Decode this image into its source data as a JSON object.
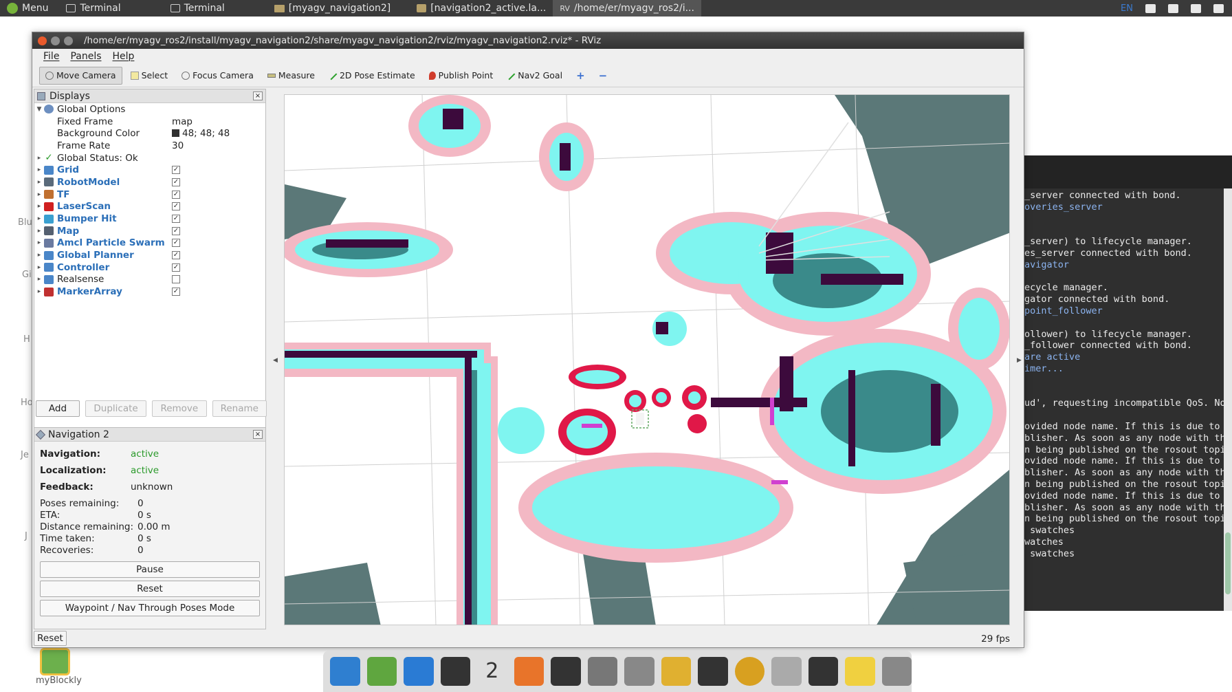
{
  "system_bar": {
    "items": [
      {
        "label": "Menu",
        "icon": "menu-icon"
      },
      {
        "label": "Terminal",
        "icon": "terminal-icon"
      },
      {
        "label": "Terminal",
        "icon": "terminal-icon"
      },
      {
        "label": "[myagv_navigation2]",
        "icon": "folder-icon"
      },
      {
        "label": "[navigation2_active.la...",
        "icon": "file-icon"
      },
      {
        "label": "/home/er/myagv_ros2/i...",
        "icon": "rviz-icon"
      }
    ],
    "lang": "EN"
  },
  "window": {
    "title": "/home/er/myagv_ros2/install/myagv_navigation2/share/myagv_navigation2/rviz/myagv_navigation2.rviz* - RViz"
  },
  "menubar": [
    "File",
    "Panels",
    "Help"
  ],
  "toolbar": {
    "tools": [
      {
        "label": "Move Camera",
        "icon": "move-camera-icon",
        "active": true
      },
      {
        "label": "Select",
        "icon": "select-icon"
      },
      {
        "label": "Focus Camera",
        "icon": "focus-camera-icon"
      },
      {
        "label": "Measure",
        "icon": "ruler-icon"
      },
      {
        "label": "2D Pose Estimate",
        "icon": "pose-estimate-icon"
      },
      {
        "label": "Publish Point",
        "icon": "pin-icon"
      },
      {
        "label": "Nav2 Goal",
        "icon": "goal-arrow-icon"
      }
    ]
  },
  "displays": {
    "title": "Displays",
    "global_options": {
      "label": "Global Options",
      "fixed_frame_label": "Fixed Frame",
      "fixed_frame": "map",
      "bg_color_label": "Background Color",
      "bg_color": "48; 48; 48",
      "frame_rate_label": "Frame Rate",
      "frame_rate": "30"
    },
    "global_status": "Global Status: Ok",
    "items": [
      {
        "label": "Grid",
        "checked": true,
        "color": "#2b6fb8"
      },
      {
        "label": "RobotModel",
        "checked": true
      },
      {
        "label": "TF",
        "checked": true
      },
      {
        "label": "LaserScan",
        "checked": true
      },
      {
        "label": "Bumper Hit",
        "checked": true
      },
      {
        "label": "Map",
        "checked": true
      },
      {
        "label": "Amcl Particle Swarm",
        "checked": true
      },
      {
        "label": "Global Planner",
        "checked": true
      },
      {
        "label": "Controller",
        "checked": true
      },
      {
        "label": "Realsense",
        "checked": false
      },
      {
        "label": "MarkerArray",
        "checked": true
      }
    ],
    "buttons": {
      "add": "Add",
      "duplicate": "Duplicate",
      "remove": "Remove",
      "rename": "Rename"
    }
  },
  "navigation": {
    "title": "Navigation 2",
    "navigation_label": "Navigation:",
    "navigation": "active",
    "localization_label": "Localization:",
    "localization": "active",
    "feedback_label": "Feedback:",
    "feedback": "unknown",
    "poses_label": "Poses remaining:",
    "poses": "0",
    "eta_label": "ETA:",
    "eta": "0 s",
    "distance_label": "Distance remaining:",
    "distance": "0.00 m",
    "time_label": "Time taken:",
    "time": "0 s",
    "recoveries_label": "Recoveries:",
    "recoveries": "0",
    "pause": "Pause",
    "reset": "Reset",
    "waypoint": "Waypoint / Nav Through Poses Mode"
  },
  "status_bar": {
    "reset": "Reset",
    "fps": "29 fps"
  },
  "terminal": {
    "lines": [
      {
        "t": "_server connected with bond.",
        "hl": false
      },
      {
        "t": "overies_server",
        "hl": true
      },
      {
        "t": "",
        "hl": false
      },
      {
        "t": "",
        "hl": false
      },
      {
        "t": "_server) to lifecycle manager.",
        "hl": false
      },
      {
        "t": "es_server connected with bond.",
        "hl": false
      },
      {
        "t": "avigator",
        "hl": true
      },
      {
        "t": "",
        "hl": false
      },
      {
        "t": "ecycle manager.",
        "hl": false
      },
      {
        "t": "gator connected with bond.",
        "hl": false
      },
      {
        "t": "point_follower",
        "hl": true
      },
      {
        "t": "",
        "hl": false
      },
      {
        "t": "ollower) to lifecycle manager.",
        "hl": false
      },
      {
        "t": "_follower connected with bond.",
        "hl": false
      },
      {
        "t": "are active",
        "hl": true
      },
      {
        "t": "imer...",
        "hl": true
      },
      {
        "t": "",
        "hl": false
      },
      {
        "t": "",
        "hl": false
      },
      {
        "t": "ud', requesting incompatible QoS. No me",
        "hl": false
      },
      {
        "t": "",
        "hl": false
      },
      {
        "t": "ovided node name. If this is due to mul",
        "hl": false
      },
      {
        "t": "blisher. As soon as any node with that",
        "hl": false
      },
      {
        "t": "n being published on the rosout topic.",
        "hl": false
      },
      {
        "t": "ovided node name. If this is due to mul",
        "hl": false
      },
      {
        "t": "blisher. As soon as any node with that",
        "hl": false
      },
      {
        "t": "n being published on the rosout topic.",
        "hl": false
      },
      {
        "t": "ovided node name. If this is due to mul",
        "hl": false
      },
      {
        "t": "blisher. As soon as any node with that",
        "hl": false
      },
      {
        "t": "n being published on the rosout topic.",
        "hl": false
      },
      {
        "t": " swatches",
        "hl": false
      },
      {
        "t": "watches",
        "hl": false
      },
      {
        "t": " swatches",
        "hl": false
      }
    ]
  },
  "desktop": {
    "ghost_labels": [
      "Blu",
      "Gi",
      "H",
      "Ho",
      "Je",
      "J"
    ],
    "icon_label": "myBlockly"
  },
  "dock": {
    "icons": [
      "anchor-icon",
      "sticky-notes-icon",
      "vscode-icon",
      "apps-grid-icon",
      "workspaces-icon",
      "firefox-icon",
      "terminal-icon",
      "files-icon",
      "text-editor-icon",
      "boards-icon",
      "monitor-icon",
      "disc-icon",
      "trash-icon",
      "apps-icon",
      "notepad-icon",
      "rviz-icon"
    ],
    "workspace_num": "2"
  },
  "colors": {
    "free": "#ffffff",
    "occupied": "#3c0a3c",
    "costmap_cyan": "#7ff5f0",
    "costmap_teal": "#3a8a8a",
    "inflation_pink": "#f3b8c4",
    "unknown": "#5b7878",
    "lethal_red": "#e01848"
  }
}
